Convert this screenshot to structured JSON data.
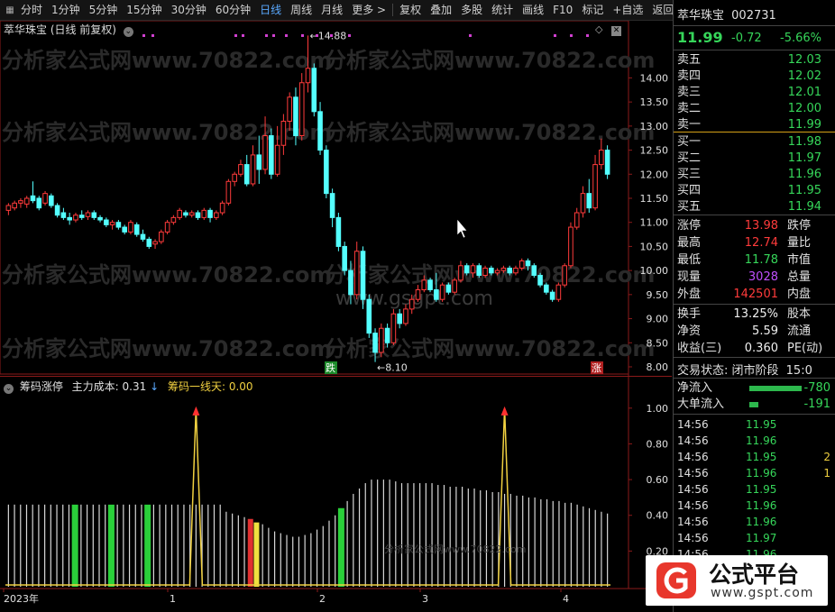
{
  "toolbar": {
    "periods": [
      "分时",
      "1分钟",
      "5分钟",
      "15分钟",
      "30分钟",
      "60分钟",
      "日线",
      "周线",
      "月线",
      "更多 >"
    ],
    "active_period": "日线",
    "tools": [
      "复权",
      "叠加",
      "多股",
      "统计",
      "画线",
      "F10",
      "标记",
      "+自选",
      "返回"
    ]
  },
  "main_pane": {
    "title": "萃华珠宝 (日线 前复权)",
    "high_label": "14.88",
    "low_label": "8.10",
    "watermark_center": "www.gsgpt.com",
    "watermark_site": "分析家公式网www.70822.com",
    "marker_down": "跌",
    "marker_up": "涨",
    "y_axis_ticks": [
      "14.00",
      "13.50",
      "13.00",
      "12.50",
      "12.00",
      "11.50",
      "11.00",
      "10.50",
      "10.00",
      "9.50",
      "9.00",
      "8.50",
      "8.00"
    ]
  },
  "sub_pane": {
    "name": "筹码涨停",
    "cost_label": "主力成本: 0.31",
    "line_label": "筹码一线天: 0.00",
    "y_axis_ticks": [
      "1.00",
      "0.80",
      "0.60",
      "0.40",
      "0.20"
    ]
  },
  "x_axis": {
    "labels": [
      "2023年",
      "1",
      "2",
      "3",
      "4"
    ]
  },
  "quote": {
    "name": "萃华珠宝",
    "code": "002731",
    "price": "11.99",
    "change": "-0.72",
    "change_pct": "-5.66%",
    "asks": [
      {
        "label": "卖五",
        "price": "12.03"
      },
      {
        "label": "卖四",
        "price": "12.02"
      },
      {
        "label": "卖三",
        "price": "12.01"
      },
      {
        "label": "卖二",
        "price": "12.00"
      },
      {
        "label": "卖一",
        "price": "11.99"
      }
    ],
    "bids": [
      {
        "label": "买一",
        "price": "11.98"
      },
      {
        "label": "买二",
        "price": "11.97"
      },
      {
        "label": "买三",
        "price": "11.96"
      },
      {
        "label": "买四",
        "price": "11.95"
      },
      {
        "label": "买五",
        "price": "11.94"
      }
    ],
    "stats": [
      {
        "l1": "涨停",
        "v": "13.98",
        "c": "red",
        "l2": "跌停"
      },
      {
        "l1": "最高",
        "v": "12.74",
        "c": "red",
        "l2": "量比"
      },
      {
        "l1": "最低",
        "v": "11.78",
        "c": "green",
        "l2": "市值"
      },
      {
        "l1": "现量",
        "v": "3028",
        "c": "purple",
        "l2": "总量"
      },
      {
        "l1": "外盘",
        "v": "142501",
        "c": "red",
        "l2": "内盘"
      }
    ],
    "stats2": [
      {
        "l1": "换手",
        "v": "13.25%",
        "l2": "股本"
      },
      {
        "l1": "净资",
        "v": "5.59",
        "l2": "流通"
      },
      {
        "l1": "收益(三)",
        "v": "0.360",
        "l2": "PE(动)"
      }
    ],
    "trade_status": "交易状态: 闭市阶段",
    "trade_time": "15:0",
    "flows": [
      {
        "label": "净流入",
        "value": "-780"
      },
      {
        "label": "大单流入",
        "value": "-191"
      }
    ],
    "ticks": [
      {
        "time": "14:56",
        "price": "11.95",
        "vol": ""
      },
      {
        "time": "14:56",
        "price": "11.96",
        "vol": ""
      },
      {
        "time": "14:56",
        "price": "11.95",
        "vol": "2"
      },
      {
        "time": "14:56",
        "price": "11.96",
        "vol": "1"
      },
      {
        "time": "14:56",
        "price": "11.95",
        "vol": ""
      },
      {
        "time": "14:56",
        "price": "11.96",
        "vol": ""
      },
      {
        "time": "14:56",
        "price": "11.96",
        "vol": ""
      },
      {
        "time": "14:56",
        "price": "11.97",
        "vol": ""
      },
      {
        "time": "14:56",
        "price": "11.96",
        "vol": ""
      }
    ]
  },
  "logo": {
    "text": "公式平台",
    "url": "www.gspt.com"
  },
  "chart_data": {
    "type": "candlestick",
    "title": "萃华珠宝 (日线 前复权)",
    "ylim": [
      7.85,
      15.0
    ],
    "candles": [
      [
        11.25,
        11.35,
        11.15,
        11.4
      ],
      [
        11.3,
        11.4,
        11.25,
        11.45
      ],
      [
        11.4,
        11.45,
        11.3,
        11.5
      ],
      [
        11.38,
        11.5,
        11.3,
        11.55
      ],
      [
        11.55,
        11.45,
        11.4,
        11.85
      ],
      [
        11.5,
        11.3,
        11.25,
        11.55
      ],
      [
        11.4,
        11.6,
        11.35,
        11.65
      ],
      [
        11.55,
        11.35,
        11.3,
        11.6
      ],
      [
        11.35,
        11.15,
        11.1,
        11.4
      ],
      [
        11.2,
        11.1,
        11.05,
        11.3
      ],
      [
        11.1,
        11.05,
        10.95,
        11.2
      ],
      [
        11.05,
        11.15,
        11.0,
        11.2
      ],
      [
        11.15,
        11.1,
        11.05,
        11.25
      ],
      [
        11.12,
        11.2,
        11.05,
        11.25
      ],
      [
        11.2,
        11.1,
        11.05,
        11.25
      ],
      [
        11.1,
        11.05,
        11.0,
        11.15
      ],
      [
        11.05,
        10.95,
        10.9,
        11.1
      ],
      [
        10.95,
        11.0,
        10.85,
        11.05
      ],
      [
        11.0,
        10.9,
        10.85,
        11.05
      ],
      [
        10.9,
        10.8,
        10.75,
        10.95
      ],
      [
        10.8,
        11.0,
        10.75,
        11.05
      ],
      [
        10.95,
        10.75,
        10.7,
        11.0
      ],
      [
        10.75,
        10.65,
        10.6,
        10.85
      ],
      [
        10.65,
        10.5,
        10.45,
        10.7
      ],
      [
        10.55,
        10.6,
        10.45,
        10.65
      ],
      [
        10.6,
        10.8,
        10.55,
        10.85
      ],
      [
        10.8,
        11.0,
        10.75,
        11.05
      ],
      [
        11.0,
        11.1,
        10.95,
        11.15
      ],
      [
        11.1,
        11.25,
        11.05,
        11.3
      ],
      [
        11.2,
        11.15,
        11.1,
        11.25
      ],
      [
        11.15,
        11.2,
        11.1,
        11.25
      ],
      [
        11.2,
        11.1,
        11.05,
        11.25
      ],
      [
        11.1,
        11.25,
        11.05,
        11.3
      ],
      [
        11.25,
        11.1,
        11.0,
        11.3
      ],
      [
        11.1,
        11.2,
        11.05,
        11.25
      ],
      [
        11.2,
        11.4,
        11.15,
        11.45
      ],
      [
        11.4,
        11.85,
        11.35,
        11.9
      ],
      [
        11.85,
        12.0,
        11.75,
        12.05
      ],
      [
        12.0,
        12.2,
        11.95,
        12.3
      ],
      [
        12.2,
        11.8,
        11.75,
        12.4
      ],
      [
        11.8,
        12.4,
        11.75,
        12.6
      ],
      [
        12.4,
        12.1,
        11.8,
        12.8
      ],
      [
        12.1,
        12.8,
        12.0,
        13.2
      ],
      [
        12.8,
        12.0,
        11.9,
        12.95
      ],
      [
        12.0,
        12.6,
        11.95,
        13.0
      ],
      [
        12.6,
        13.1,
        12.4,
        13.25
      ],
      [
        13.1,
        13.6,
        12.9,
        13.7
      ],
      [
        13.6,
        12.8,
        12.6,
        13.8
      ],
      [
        12.8,
        13.9,
        12.7,
        14.1
      ],
      [
        13.9,
        14.2,
        13.7,
        14.88
      ],
      [
        14.2,
        13.3,
        13.2,
        14.3
      ],
      [
        13.3,
        12.5,
        12.4,
        13.5
      ],
      [
        12.5,
        11.6,
        11.5,
        12.6
      ],
      [
        11.6,
        11.1,
        10.9,
        11.7
      ],
      [
        11.1,
        10.5,
        10.4,
        11.2
      ],
      [
        10.5,
        10.0,
        9.9,
        10.6
      ],
      [
        10.0,
        9.5,
        9.3,
        10.2
      ],
      [
        9.5,
        10.4,
        9.4,
        10.6
      ],
      [
        10.4,
        9.4,
        9.2,
        10.5
      ],
      [
        9.4,
        8.7,
        8.6,
        9.5
      ],
      [
        8.7,
        8.3,
        8.1,
        8.8
      ],
      [
        8.3,
        8.8,
        8.2,
        8.9
      ],
      [
        8.8,
        8.5,
        8.4,
        8.9
      ],
      [
        8.5,
        9.1,
        8.45,
        9.2
      ],
      [
        9.1,
        8.9,
        8.8,
        9.2
      ],
      [
        8.9,
        9.2,
        8.85,
        9.3
      ],
      [
        9.2,
        9.4,
        9.1,
        9.5
      ],
      [
        9.4,
        9.6,
        9.35,
        9.7
      ],
      [
        9.6,
        9.8,
        9.55,
        9.9
      ],
      [
        9.8,
        9.6,
        9.55,
        9.85
      ],
      [
        9.6,
        9.4,
        9.35,
        9.95
      ],
      [
        9.4,
        9.7,
        9.35,
        9.75
      ],
      [
        9.7,
        9.55,
        9.5,
        9.75
      ],
      [
        9.55,
        9.8,
        9.5,
        9.85
      ],
      [
        9.8,
        10.1,
        9.75,
        10.2
      ],
      [
        10.1,
        9.95,
        9.9,
        10.15
      ],
      [
        9.95,
        10.1,
        9.85,
        10.15
      ],
      [
        10.1,
        9.9,
        9.85,
        10.15
      ],
      [
        9.9,
        10.05,
        9.85,
        10.1
      ],
      [
        10.05,
        9.95,
        9.9,
        10.1
      ],
      [
        9.95,
        10.0,
        9.9,
        10.05
      ],
      [
        10.0,
        10.05,
        9.95,
        10.1
      ],
      [
        10.05,
        9.95,
        9.9,
        10.1
      ],
      [
        9.95,
        10.05,
        9.9,
        10.1
      ],
      [
        10.05,
        10.2,
        10.0,
        10.25
      ],
      [
        10.2,
        10.1,
        10.0,
        10.25
      ],
      [
        10.1,
        9.9,
        9.85,
        10.15
      ],
      [
        9.9,
        9.7,
        9.65,
        9.95
      ],
      [
        9.7,
        9.55,
        9.5,
        9.75
      ],
      [
        9.55,
        9.4,
        9.35,
        9.6
      ],
      [
        9.4,
        9.7,
        9.35,
        9.75
      ],
      [
        9.7,
        10.1,
        9.65,
        10.15
      ],
      [
        10.1,
        10.9,
        10.05,
        11.0
      ],
      [
        10.9,
        11.2,
        10.85,
        11.3
      ],
      [
        11.2,
        11.6,
        11.1,
        11.75
      ],
      [
        11.6,
        11.3,
        11.2,
        11.9
      ],
      [
        11.3,
        12.2,
        11.25,
        12.4
      ],
      [
        12.2,
        12.5,
        12.1,
        12.74
      ],
      [
        12.5,
        12.0,
        11.9,
        12.6
      ]
    ],
    "indicator": {
      "name": "筹码涨停",
      "ylim": [
        0,
        1.1
      ],
      "bars": [
        0.46,
        0.46,
        0.46,
        0.46,
        0.46,
        0.46,
        0.46,
        0.46,
        0.46,
        0.46,
        0.46,
        0.46,
        0.46,
        0.46,
        0.46,
        0.46,
        0.46,
        0.46,
        0.46,
        0.46,
        0.46,
        0.46,
        0.46,
        0.46,
        0.46,
        0.46,
        0.46,
        0.46,
        0.46,
        0.46,
        0.46,
        0.46,
        0.46,
        0.46,
        0.46,
        0.46,
        0.42,
        0.41,
        0.4,
        0.39,
        0.38,
        0.36,
        0.35,
        0.33,
        0.31,
        0.3,
        0.29,
        0.28,
        0.28,
        0.29,
        0.3,
        0.32,
        0.34,
        0.37,
        0.4,
        0.44,
        0.48,
        0.52,
        0.55,
        0.58,
        0.6,
        0.6,
        0.6,
        0.6,
        0.59,
        0.58,
        0.58,
        0.58,
        0.58,
        0.58,
        0.58,
        0.57,
        0.57,
        0.56,
        0.56,
        0.56,
        0.55,
        0.55,
        0.54,
        0.54,
        0.53,
        0.53,
        0.52,
        0.52,
        0.51,
        0.51,
        0.5,
        0.5,
        0.49,
        0.49,
        0.48,
        0.48,
        0.47,
        0.47,
        0.46,
        0.45,
        0.44,
        0.43,
        0.42,
        0.41
      ],
      "green_bars": [
        11,
        17,
        23,
        55
      ],
      "red_bars": [
        40
      ],
      "yellow_bars": [
        41
      ],
      "spikes": [
        31,
        82
      ]
    }
  }
}
